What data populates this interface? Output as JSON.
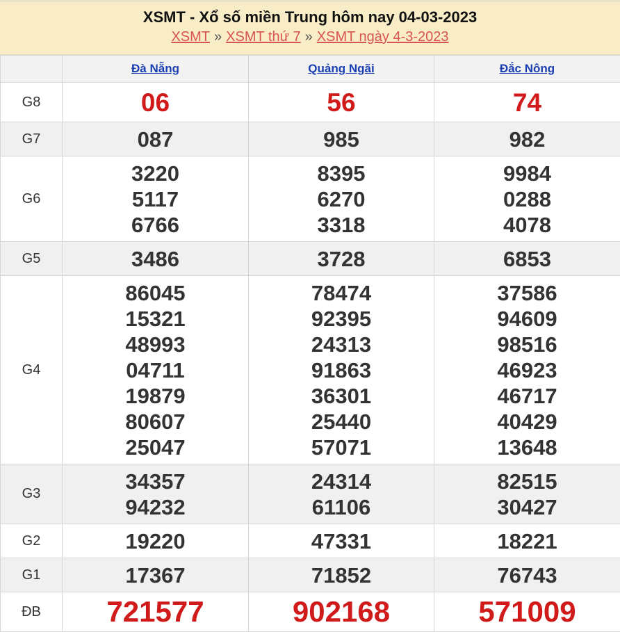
{
  "header": {
    "title": "XSMT - Xổ số miền Trung hôm nay 04-03-2023",
    "crumbs": [
      "XSMT",
      "XSMT thứ 7",
      "XSMT ngày 4-3-2023"
    ],
    "separator": "»"
  },
  "provinces": [
    "Đà Nẵng",
    "Quảng Ngãi",
    "Đắc Nông"
  ],
  "prizes": {
    "G8": {
      "label": "G8",
      "values": [
        [
          "06"
        ],
        [
          "56"
        ],
        [
          "74"
        ]
      ]
    },
    "G7": {
      "label": "G7",
      "values": [
        [
          "087"
        ],
        [
          "985"
        ],
        [
          "982"
        ]
      ]
    },
    "G6": {
      "label": "G6",
      "values": [
        [
          "3220",
          "5117",
          "6766"
        ],
        [
          "8395",
          "6270",
          "3318"
        ],
        [
          "9984",
          "0288",
          "4078"
        ]
      ]
    },
    "G5": {
      "label": "G5",
      "values": [
        [
          "3486"
        ],
        [
          "3728"
        ],
        [
          "6853"
        ]
      ]
    },
    "G4": {
      "label": "G4",
      "values": [
        [
          "86045",
          "15321",
          "48993",
          "04711",
          "19879",
          "80607",
          "25047"
        ],
        [
          "78474",
          "92395",
          "24313",
          "91863",
          "36301",
          "25440",
          "57071"
        ],
        [
          "37586",
          "94609",
          "98516",
          "46923",
          "46717",
          "40429",
          "13648"
        ]
      ]
    },
    "G3": {
      "label": "G3",
      "values": [
        [
          "34357",
          "94232"
        ],
        [
          "24314",
          "61106"
        ],
        [
          "82515",
          "30427"
        ]
      ]
    },
    "G2": {
      "label": "G2",
      "values": [
        [
          "19220"
        ],
        [
          "47331"
        ],
        [
          "18221"
        ]
      ]
    },
    "G1": {
      "label": "G1",
      "values": [
        [
          "17367"
        ],
        [
          "71852"
        ],
        [
          "76743"
        ]
      ]
    },
    "DB": {
      "label": "ĐB",
      "values": [
        [
          "721577"
        ],
        [
          "902168"
        ],
        [
          "571009"
        ]
      ]
    }
  },
  "colors": {
    "header_bg": "#f8edc7",
    "link": "#d9534f",
    "province_link": "#1a3fb2",
    "highlight": "#d11a1a",
    "alt_row": "#f0f0f0"
  }
}
